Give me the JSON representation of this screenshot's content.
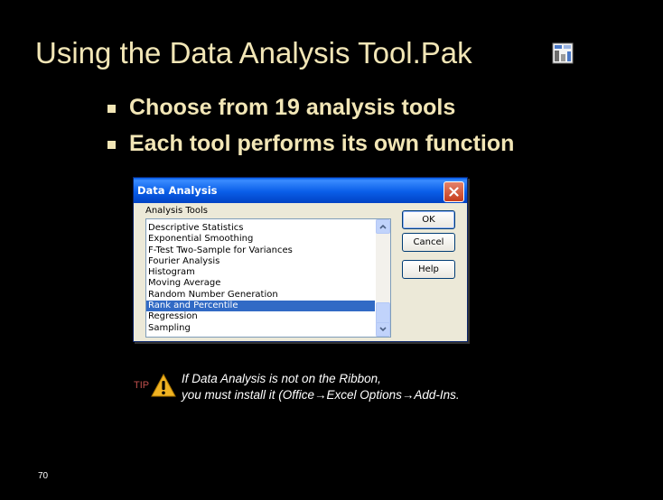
{
  "slide": {
    "title": "Using the Data Analysis Tool.Pak",
    "bullets": [
      "Choose from 19 analysis tools",
      "Each tool performs its own function"
    ],
    "page_number": "70"
  },
  "dialog": {
    "title": "Data Analysis",
    "group_label": "Analysis Tools",
    "items": [
      "Descriptive Statistics",
      "Exponential Smoothing",
      "F-Test Two-Sample for Variances",
      "Fourier Analysis",
      "Histogram",
      "Moving Average",
      "Random Number Generation",
      "Rank and Percentile",
      "Regression",
      "Sampling"
    ],
    "selected_item": "Rank and Percentile",
    "buttons": {
      "ok": "OK",
      "cancel": "Cancel",
      "help": "Help"
    }
  },
  "tip": {
    "label": "TIP",
    "line1": "If Data Analysis is not on the Ribbon,",
    "line2": "you must install it (Office→Excel Options→Add-Ins."
  },
  "colors": {
    "background": "#000000",
    "title_text": "#f2e6b6",
    "selection": "#316ac5",
    "titlebar": "#0a5ee8",
    "tip_label": "#c0504d"
  },
  "icons": {
    "title_icon": "data-analysis-icon",
    "tip_icon": "warning-icon",
    "close_icon": "close-icon"
  }
}
